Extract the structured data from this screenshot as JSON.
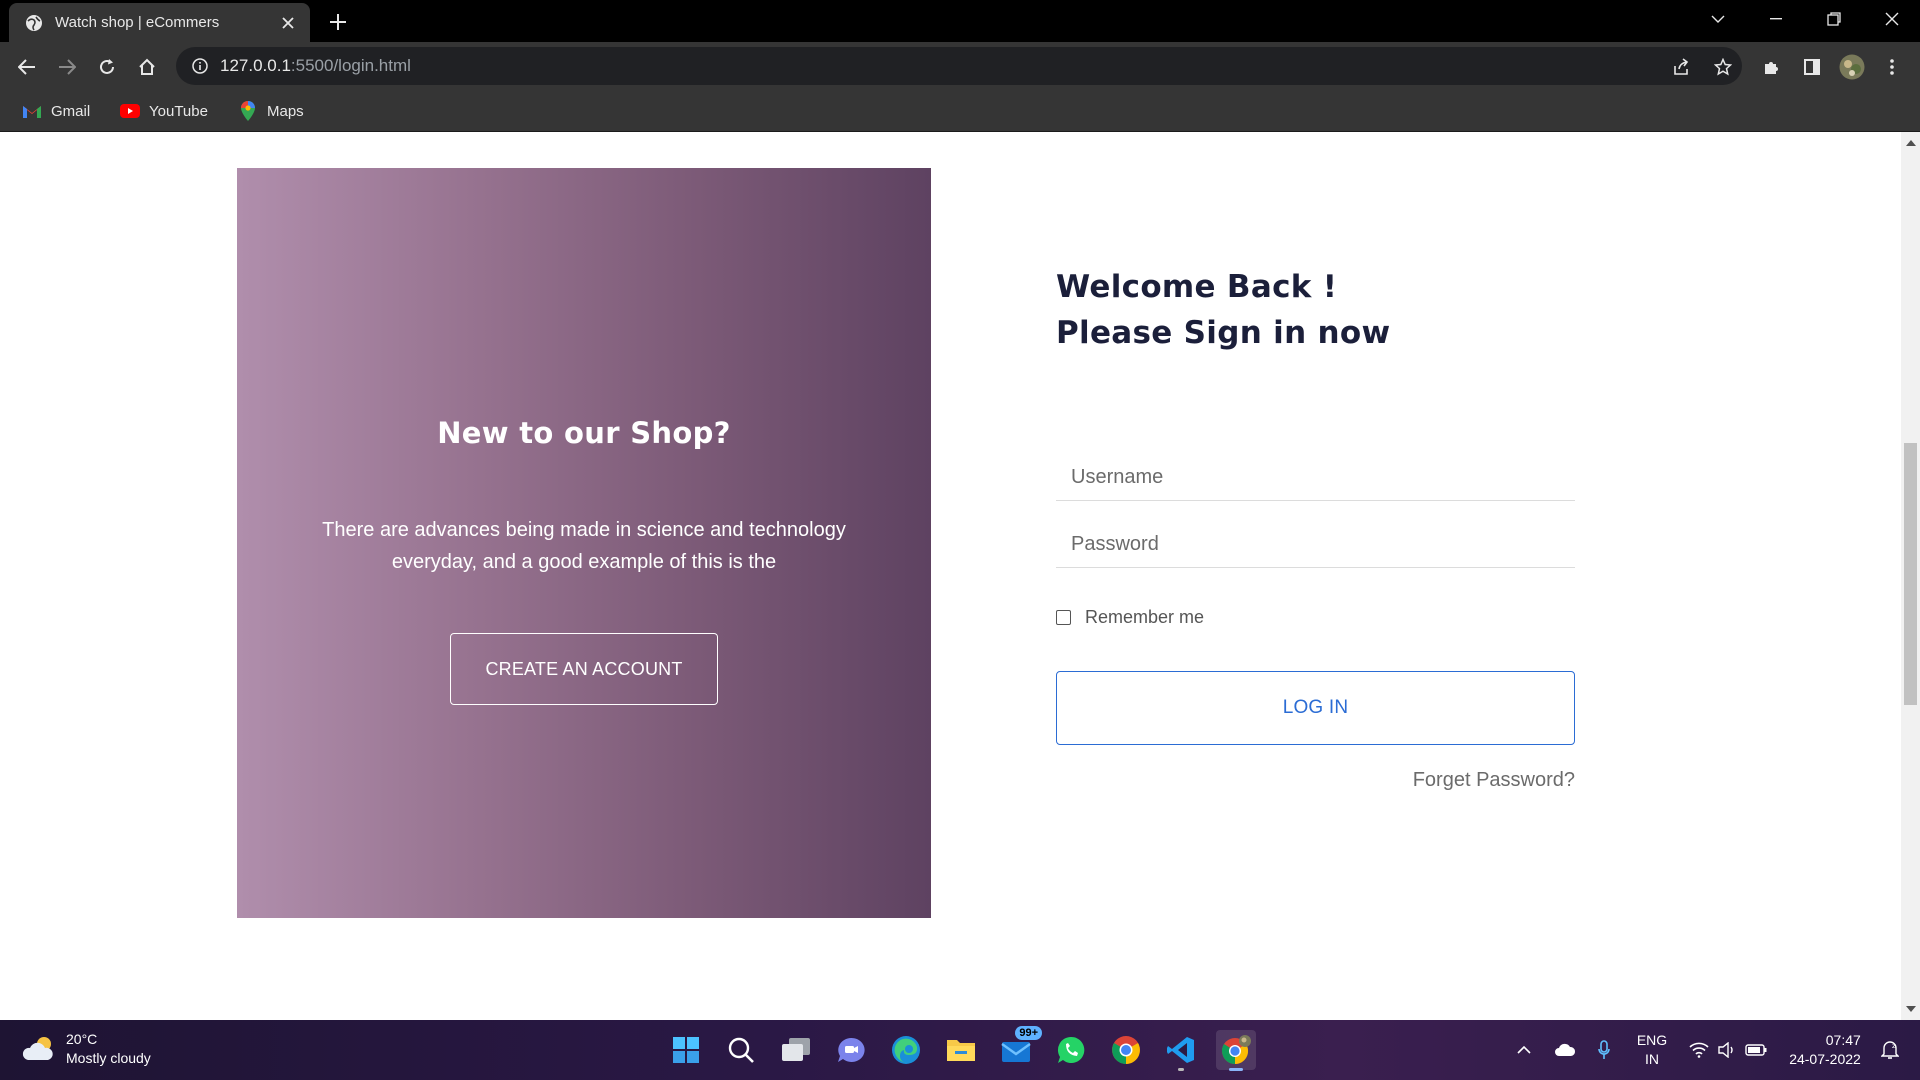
{
  "browser": {
    "tab_title": "Watch shop | eCommers",
    "url_host": "127.0.0.1",
    "url_path": ":5500/login.html",
    "bookmarks": [
      {
        "label": "Gmail",
        "icon": "gmail-icon"
      },
      {
        "label": "YouTube",
        "icon": "youtube-icon"
      },
      {
        "label": "Maps",
        "icon": "maps-icon"
      }
    ]
  },
  "promo": {
    "heading": "New to our Shop?",
    "text": "There are advances being made in science and technology everyday, and a good example of this is the",
    "button": "CREATE AN ACCOUNT",
    "gradient": [
      "#b08eac",
      "#5e4261"
    ]
  },
  "login": {
    "heading_line1": "Welcome Back !",
    "heading_line2": "Please Sign in now",
    "username_placeholder": "Username",
    "password_placeholder": "Password",
    "remember_label": "Remember me",
    "login_button": "LOG IN",
    "forget_link": "Forget Password?",
    "accent": "#2b6cd4"
  },
  "taskbar": {
    "weather_temp": "20°C",
    "weather_desc": "Mostly cloudy",
    "mail_badge": "99+",
    "lang_line1": "ENG",
    "lang_line2": "IN",
    "time": "07:47",
    "date": "24-07-2022",
    "apps": [
      "start-icon",
      "search-icon",
      "task-view-icon",
      "teams-chat-icon",
      "edge-icon",
      "file-explorer-icon",
      "mail-icon",
      "whatsapp-icon",
      "chrome-icon",
      "vscode-icon",
      "chrome-profile-icon"
    ]
  }
}
